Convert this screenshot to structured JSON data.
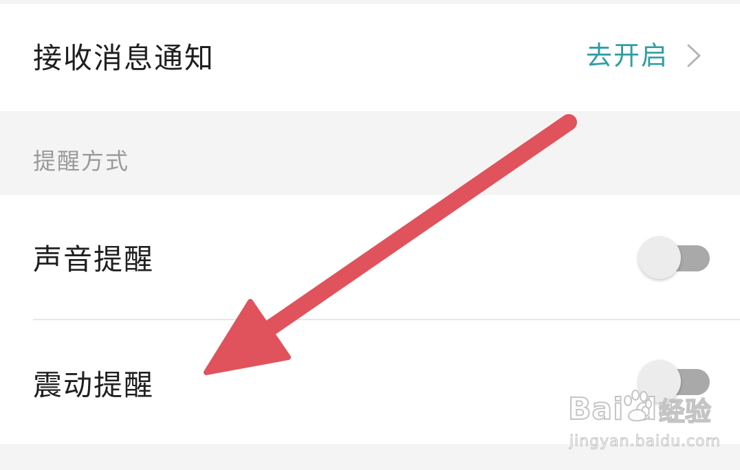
{
  "notifications": {
    "label": "接收消息通知",
    "action_label": "去开启",
    "action_color": "#2e9ea3"
  },
  "reminder_section": {
    "title": "提醒方式",
    "items": [
      {
        "label": "声音提醒",
        "enabled": false
      },
      {
        "label": "震动提醒",
        "enabled": false
      }
    ]
  },
  "annotation": {
    "icon": "arrow-icon",
    "color": "#e0535c"
  },
  "watermark": {
    "brand": "Bai  du",
    "jingyan": "经验",
    "url": "jingyan.baidu.com"
  }
}
